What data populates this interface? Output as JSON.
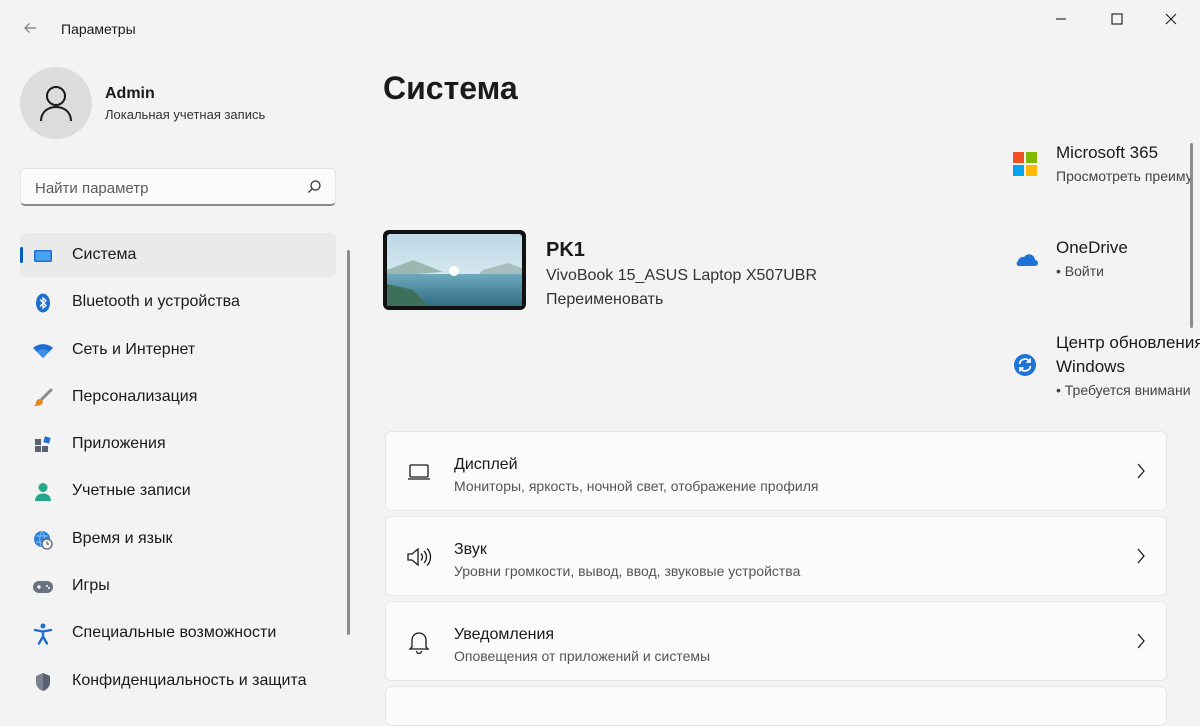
{
  "window": {
    "title": "Параметры",
    "controls": [
      "minimize",
      "maximize",
      "close"
    ]
  },
  "profile": {
    "name": "Admin",
    "account_type": "Локальная учетная запись"
  },
  "search": {
    "placeholder": "Найти параметр"
  },
  "sidebar": {
    "items": [
      {
        "label": "Система",
        "icon": "system-icon",
        "active": true
      },
      {
        "label": "Bluetooth и устройства",
        "icon": "bluetooth-icon"
      },
      {
        "label": "Сеть и Интернет",
        "icon": "wifi-icon"
      },
      {
        "label": "Персонализация",
        "icon": "brush-icon"
      },
      {
        "label": "Приложения",
        "icon": "apps-icon"
      },
      {
        "label": "Учетные записи",
        "icon": "accounts-icon"
      },
      {
        "label": "Время и язык",
        "icon": "time-language-icon"
      },
      {
        "label": "Игры",
        "icon": "gamepad-icon"
      },
      {
        "label": "Специальные возможности",
        "icon": "accessibility-icon"
      },
      {
        "label": "Конфиденциальность и защита",
        "icon": "shield-icon"
      }
    ]
  },
  "main": {
    "title": "Система",
    "device": {
      "name": "PK1",
      "model": "VivoBook 15_ASUS Laptop X507UBR",
      "rename": "Переименовать"
    },
    "quick": [
      {
        "title": "Microsoft 365",
        "subtitle": "Просмотреть преиму",
        "icon": "microsoft-icon"
      },
      {
        "title": "OneDrive",
        "subtitle": "• Войти",
        "icon": "onedrive-icon"
      },
      {
        "title": "Центр обновления",
        "title2": "Windows",
        "subtitle": "• Требуется внимани",
        "icon": "windows-update-icon"
      }
    ],
    "cards": [
      {
        "title": "Дисплей",
        "subtitle": "Мониторы, яркость, ночной свет, отображение профиля",
        "icon": "display-icon"
      },
      {
        "title": "Звук",
        "subtitle": "Уровни громкости, вывод, ввод, звуковые устройства",
        "icon": "speaker-icon"
      },
      {
        "title": "Уведомления",
        "subtitle": "Оповещения от приложений и системы",
        "icon": "bell-icon"
      }
    ]
  },
  "colors": {
    "accent": "#005fb8",
    "background": "#f3f3f3",
    "card": "#fbfbfb"
  }
}
